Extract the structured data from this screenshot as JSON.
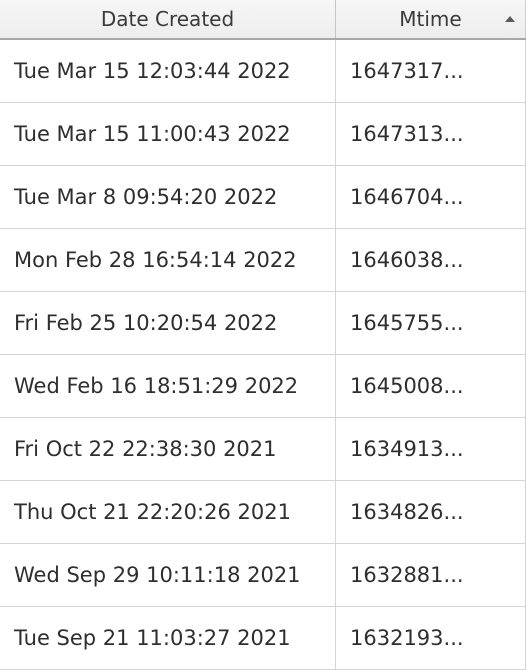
{
  "columns": {
    "date_created": "Date Created",
    "mtime": "Mtime"
  },
  "sort": {
    "column": "mtime",
    "direction": "asc"
  },
  "rows": [
    {
      "date_created": "Tue Mar 15 12:03:44 2022",
      "mtime": "1647317..."
    },
    {
      "date_created": "Tue Mar 15 11:00:43 2022",
      "mtime": "1647313..."
    },
    {
      "date_created": "Tue Mar  8 09:54:20 2022",
      "mtime": "1646704..."
    },
    {
      "date_created": "Mon Feb 28 16:54:14 2022",
      "mtime": "1646038..."
    },
    {
      "date_created": "Fri Feb 25 10:20:54 2022",
      "mtime": "1645755..."
    },
    {
      "date_created": "Wed Feb 16 18:51:29 2022",
      "mtime": "1645008..."
    },
    {
      "date_created": "Fri Oct 22 22:38:30 2021",
      "mtime": "1634913..."
    },
    {
      "date_created": "Thu Oct 21 22:20:26 2021",
      "mtime": "1634826..."
    },
    {
      "date_created": "Wed Sep 29 10:11:18 2021",
      "mtime": "1632881..."
    },
    {
      "date_created": "Tue Sep 21 11:03:27 2021",
      "mtime": "1632193..."
    }
  ]
}
